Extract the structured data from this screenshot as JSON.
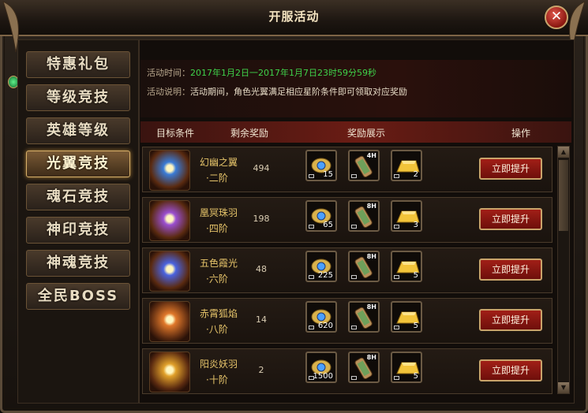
{
  "window": {
    "title": "开服活动",
    "close_label": "✕"
  },
  "sidebar": {
    "items": [
      {
        "label": "特惠礼包",
        "active": false
      },
      {
        "label": "等级竞技",
        "active": false
      },
      {
        "label": "英雄等级",
        "active": false
      },
      {
        "label": "光翼竞技",
        "active": true
      },
      {
        "label": "魂石竞技",
        "active": false
      },
      {
        "label": "神印竞技",
        "active": false
      },
      {
        "label": "神魂竞技",
        "active": false
      },
      {
        "label": "全民BOSS",
        "active": false
      }
    ]
  },
  "info": {
    "time_label": "活动时间：",
    "time_value": "2017年1月2日一2017年1月7日23时59分59秒",
    "desc_label": "活动说明：",
    "desc_value": "活动期间，角色光翼满足相应星阶条件即可领取对应奖励"
  },
  "table": {
    "headers": {
      "target": "目标条件",
      "remain": "剩余奖励",
      "reward": "奖励展示",
      "action": "操作"
    },
    "rows": [
      {
        "wing_name": "幻幽之翼",
        "stage": "·二阶",
        "remain": "494",
        "r1_count": "15",
        "r2_tag": "4H",
        "r3_count": "2",
        "action": "立即提升",
        "wing_color": "#3a7bd6"
      },
      {
        "wing_name": "凰冥珠羽",
        "stage": "·四阶",
        "remain": "198",
        "r1_count": "65",
        "r2_tag": "8H",
        "r3_count": "3",
        "action": "立即提升",
        "wing_color": "#9a4fd0"
      },
      {
        "wing_name": "五色霞光",
        "stage": "·六阶",
        "remain": "48",
        "r1_count": "225",
        "r2_tag": "8H",
        "r3_count": "5",
        "action": "立即提升",
        "wing_color": "#4a63e0"
      },
      {
        "wing_name": "赤霄狐焰",
        "stage": "·八阶",
        "remain": "14",
        "r1_count": "620",
        "r2_tag": "8H",
        "r3_count": "5",
        "action": "立即提升",
        "wing_color": "#e0782a"
      },
      {
        "wing_name": "阳炎妖羽",
        "stage": "·十阶",
        "remain": "2",
        "r1_count": "1500",
        "r2_tag": "8H",
        "r3_count": "5",
        "action": "立即提升",
        "wing_color": "#e0a02a"
      }
    ]
  },
  "scroll": {
    "up": "▲",
    "down": "▼"
  }
}
